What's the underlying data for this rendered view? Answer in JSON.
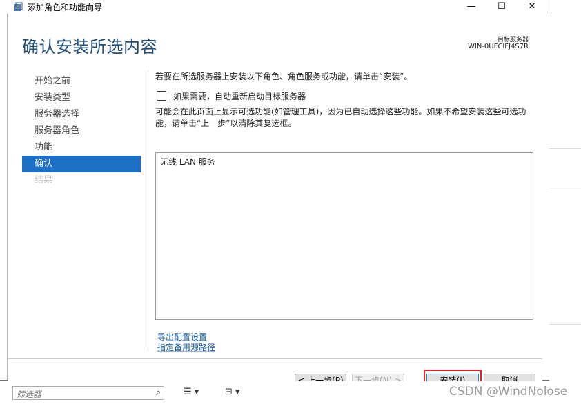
{
  "window": {
    "title": "添加角色和功能向导",
    "controls": {
      "minimize": "—",
      "maximize": "☐",
      "close": "✕"
    }
  },
  "header": {
    "heading": "确认安装所选内容",
    "server_label": "目标服务器",
    "server_name": "WIN-0UFCIFJ4S7R"
  },
  "nav": {
    "items": [
      {
        "label": "开始之前",
        "state": "normal"
      },
      {
        "label": "安装类型",
        "state": "normal"
      },
      {
        "label": "服务器选择",
        "state": "normal"
      },
      {
        "label": "服务器角色",
        "state": "normal"
      },
      {
        "label": "功能",
        "state": "normal"
      },
      {
        "label": "确认",
        "state": "active"
      },
      {
        "label": "结果",
        "state": "disabled"
      }
    ]
  },
  "content": {
    "intro": "若要在所选服务器上安装以下角色、角色服务或功能，请单击“安装”。",
    "restart_checkbox": {
      "label": "如果需要，自动重新启动目标服务器",
      "checked": false
    },
    "note": "可能会在此页面上显示可选功能(如管理工具)，因为已自动选择这些功能。如果不希望安装这些可选功能，请单击“上一步”以清除其复选框。",
    "selected_items": [
      "无线 LAN 服务"
    ],
    "links": {
      "export": "导出配置设置",
      "alternate_source": "指定备用源路径"
    }
  },
  "buttons": {
    "previous": "< 上一步(P)",
    "next": "下一步(N) >",
    "install": "安装(I)",
    "cancel": "取消"
  },
  "bottombar": {
    "filter_placeholder": "筛选器",
    "tool1": "☰ ▾",
    "tool2": "⊟ ▾"
  },
  "watermark": "CSDN @WindNolose",
  "colors": {
    "accent": "#1c6fc4",
    "heading": "#1f4e79",
    "highlight": "#e0252b"
  }
}
